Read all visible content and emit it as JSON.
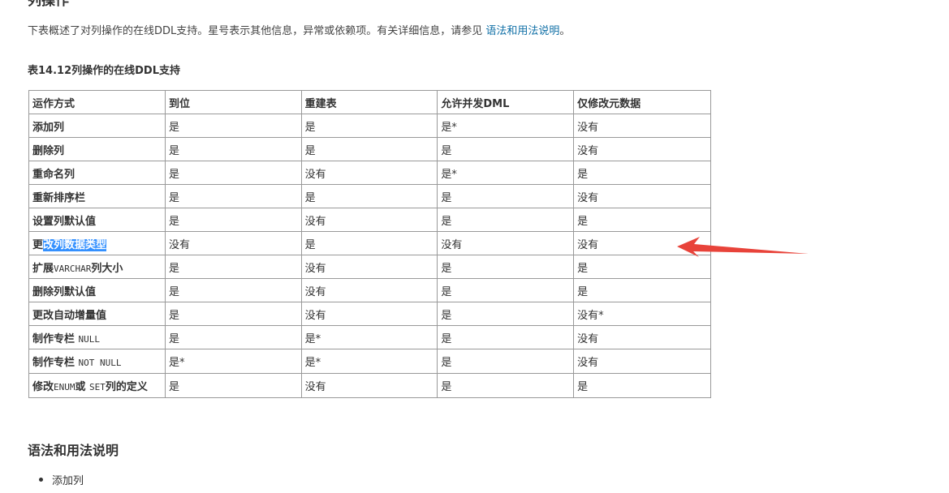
{
  "section_title": "列操作",
  "intro": {
    "text": "下表概述了对列操作的在线DDL支持。星号表示其他信息，异常或依赖项。有关详细信息，请参见 ",
    "link": "语法和用法说明",
    "suffix": "。"
  },
  "table": {
    "caption": "表14.12列操作的在线DDL支持",
    "headers": [
      "运作方式",
      "到位",
      "重建表",
      "允许并发DML",
      "仅修改元数据"
    ],
    "rows": [
      {
        "op": "添加列",
        "in_place": "是",
        "rebuild": "是",
        "dml": "是*",
        "meta": "没有"
      },
      {
        "op": "删除列",
        "in_place": "是",
        "rebuild": "是",
        "dml": "是",
        "meta": "没有"
      },
      {
        "op": "重命名列",
        "in_place": "是",
        "rebuild": "没有",
        "dml": "是*",
        "meta": "是"
      },
      {
        "op": "重新排序栏",
        "in_place": "是",
        "rebuild": "是",
        "dml": "是",
        "meta": "没有"
      },
      {
        "op": "设置列默认值",
        "in_place": "是",
        "rebuild": "没有",
        "dml": "是",
        "meta": "是"
      },
      {
        "op_pre": "更",
        "op_hl": "改列数据类型",
        "in_place": "没有",
        "rebuild": "是",
        "dml": "没有",
        "meta": "没有"
      },
      {
        "op_pre": "扩展",
        "op_code": "VARCHAR",
        "op_post": "列大小",
        "in_place": "是",
        "rebuild": "没有",
        "dml": "是",
        "meta": "是"
      },
      {
        "op": "删除列默认值",
        "in_place": "是",
        "rebuild": "没有",
        "dml": "是",
        "meta": "是"
      },
      {
        "op": "更改自动增量值",
        "in_place": "是",
        "rebuild": "没有",
        "dml": "是",
        "meta": "没有*"
      },
      {
        "op_pre": "制作专栏 ",
        "op_code": "NULL",
        "in_place": "是",
        "rebuild": "是*",
        "dml": "是",
        "meta": "没有"
      },
      {
        "op_pre": "制作专栏 ",
        "op_code": "NOT NULL",
        "in_place": "是*",
        "rebuild": "是*",
        "dml": "是",
        "meta": "没有"
      },
      {
        "op_pre": "修改",
        "op_code": "ENUM",
        "op_mid": "或 ",
        "op_code2": "SET",
        "op_post": "列的定义",
        "in_place": "是",
        "rebuild": "没有",
        "dml": "是",
        "meta": "是"
      }
    ]
  },
  "annotation": {
    "arrow_color": "#e8433a"
  },
  "selection_color": "#3390ff",
  "link_color": "#0f6fa6",
  "sub_heading": "语法和用法说明",
  "bullets": [
    "添加列"
  ]
}
